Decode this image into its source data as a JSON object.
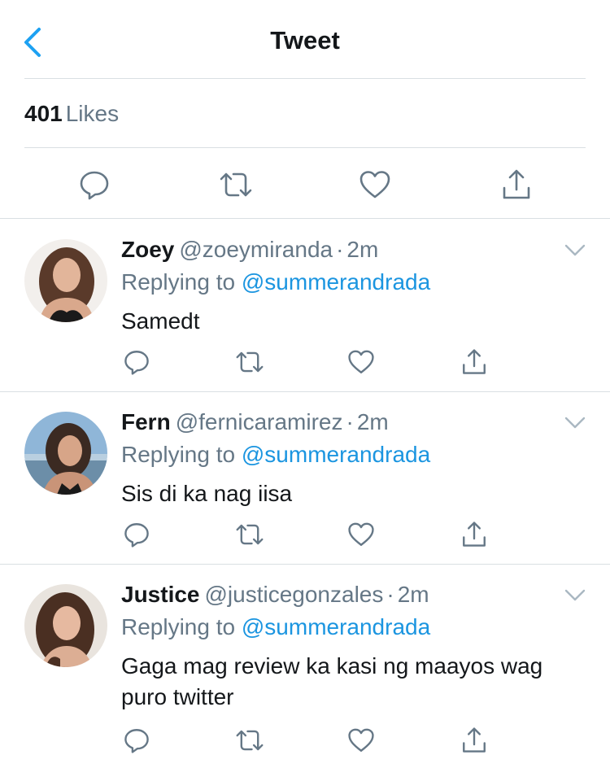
{
  "nav": {
    "title": "Tweet",
    "back_icon": "chevron-left-icon",
    "accent": "#1da1f2"
  },
  "likes": {
    "count": "401",
    "label": "Likes"
  },
  "colors": {
    "mention": "#1b95e0",
    "secondary_text": "#657786",
    "icon": "#657786",
    "divider": "#d9dfe3"
  },
  "replies": [
    {
      "name": "Zoey",
      "handle": "@zoeymiranda",
      "time": "2m",
      "replying_prefix": "Replying to",
      "replying_to": "@summerandrada",
      "text": "Samedt"
    },
    {
      "name": "Fern",
      "handle": "@fernicaramirez",
      "time": "2m",
      "replying_prefix": "Replying to",
      "replying_to": "@summerandrada",
      "text": "Sis di ka nag iisa"
    },
    {
      "name": "Justice",
      "handle": "@justicegonzales",
      "time": "2m",
      "replying_prefix": "Replying to",
      "replying_to": "@summerandrada",
      "text": "Gaga mag review ka kasi ng maayos wag puro twitter"
    }
  ]
}
